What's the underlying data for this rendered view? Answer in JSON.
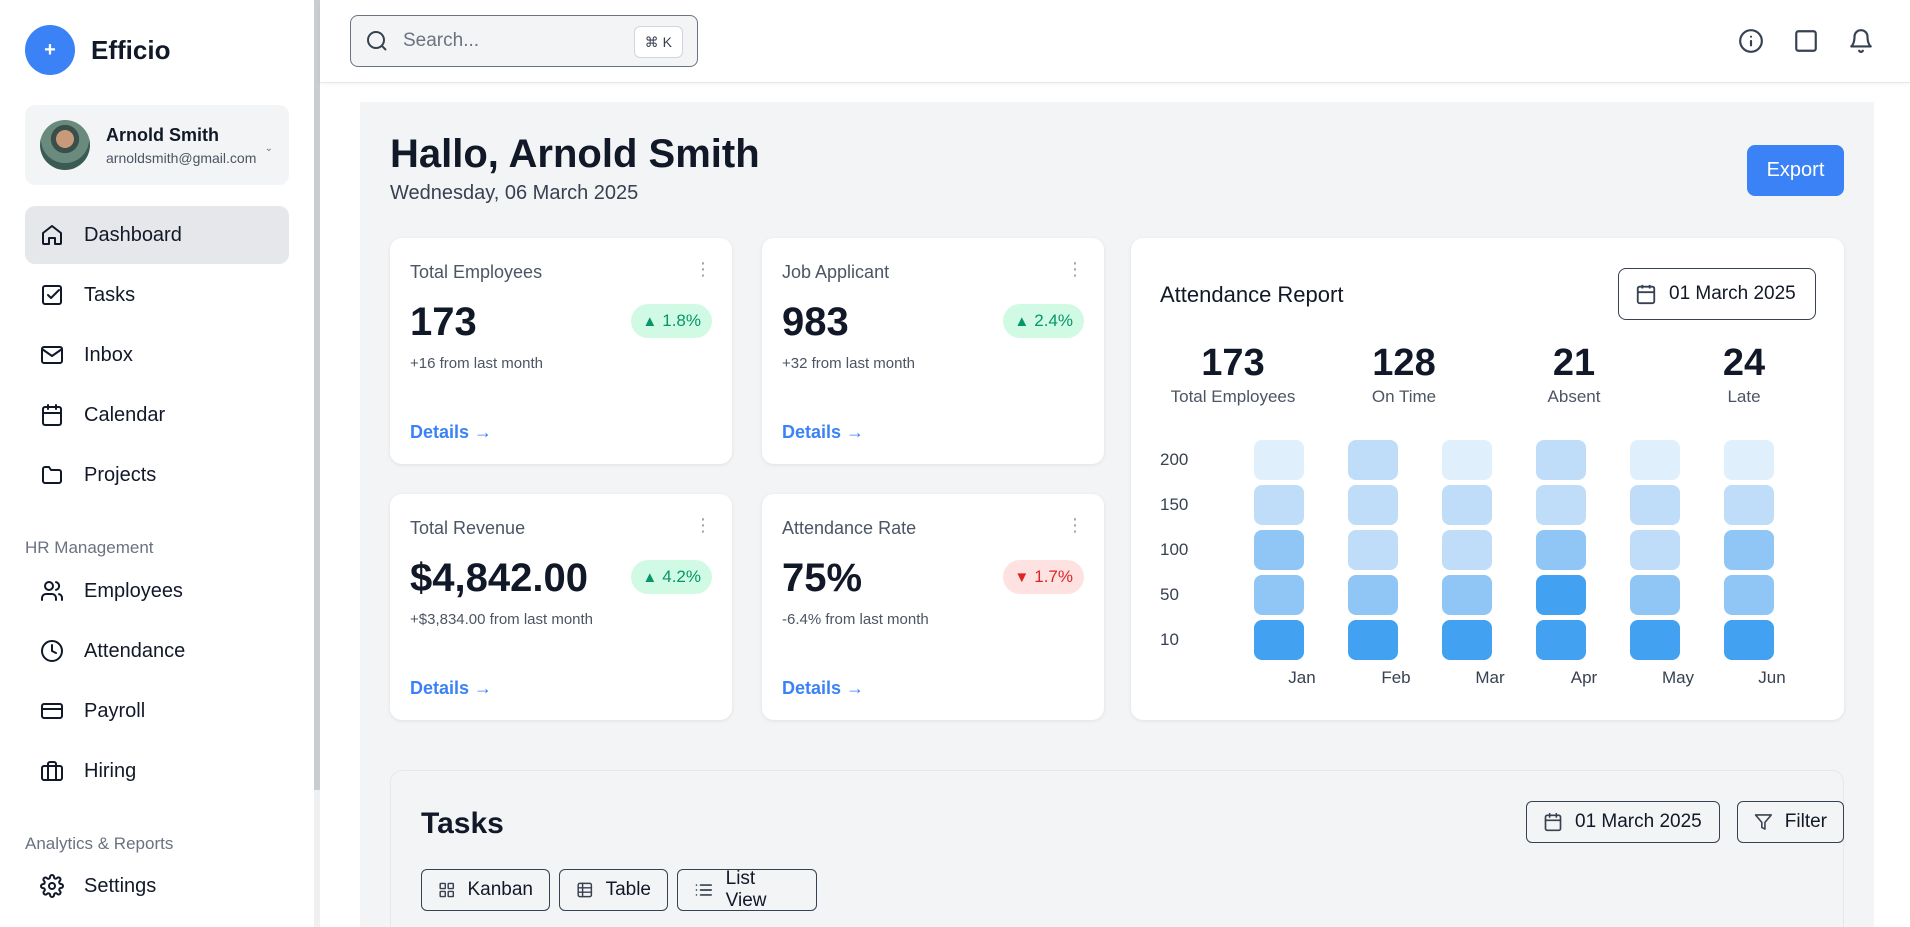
{
  "brand": {
    "logo": "+",
    "name": "Efficio"
  },
  "user": {
    "name": "Arnold Smith",
    "email": "arnoldsmith@gmail.com",
    "chevron": "⌄"
  },
  "nav": [
    {
      "label": "Dashboard",
      "icon": "home-icon",
      "active": true
    },
    {
      "label": "Tasks",
      "icon": "checkbox-icon"
    },
    {
      "label": "Inbox",
      "icon": "mail-icon"
    },
    {
      "label": "Calendar",
      "icon": "calendar-icon"
    },
    {
      "label": "Projects",
      "icon": "folder-icon"
    }
  ],
  "hr_section": {
    "label": "HR Management",
    "items": [
      {
        "label": "Employees",
        "icon": "users-icon"
      },
      {
        "label": "Attendance",
        "icon": "clock-icon"
      },
      {
        "label": "Payroll",
        "icon": "credit-card-icon"
      },
      {
        "label": "Hiring",
        "icon": "briefcase-icon"
      }
    ]
  },
  "analytics_section": {
    "label": "Analytics & Reports",
    "items": [
      {
        "label": "Settings",
        "icon": "gear-icon"
      }
    ]
  },
  "search": {
    "placeholder": "Search...",
    "shortcut": "⌘ K"
  },
  "header": {
    "greeting": "Hallo, Arnold Smith",
    "date": "Wednesday, 06 March 2025",
    "export_label": "Export"
  },
  "stats": [
    {
      "title": "Total Employees",
      "value": "173",
      "change": "1.8%",
      "direction": "up",
      "sub": "+16 from last month",
      "link": "Details →"
    },
    {
      "title": "Job Applicant",
      "value": "983",
      "change": "2.4%",
      "direction": "up",
      "sub": "+32 from last month",
      "link": "Details →"
    },
    {
      "title": "Total Revenue",
      "value": "$4,842.00",
      "change": "4.2%",
      "direction": "up",
      "sub": "+$3,834.00 from last month",
      "link": "Details →"
    },
    {
      "title": "Attendance Rate",
      "value": "75%",
      "change": "1.7%",
      "direction": "down",
      "sub": "-6.4% from last month",
      "link": "Details →"
    }
  ],
  "attendance": {
    "title": "Attendance Report",
    "date": "01 March 2025",
    "summary": [
      {
        "value": "173",
        "label": "Total Employees"
      },
      {
        "value": "128",
        "label": "On Time"
      },
      {
        "value": "21",
        "label": "Absent"
      },
      {
        "value": "24",
        "label": "Late"
      }
    ]
  },
  "chart_data": {
    "type": "heatmap",
    "title": "Attendance Report",
    "x": [
      "Jan",
      "Feb",
      "Mar",
      "Apr",
      "May",
      "Jun"
    ],
    "y": [
      "200",
      "150",
      "100",
      "50",
      "10"
    ],
    "intensity": [
      [
        1,
        2,
        1,
        2,
        1,
        1
      ],
      [
        2,
        2,
        2,
        2,
        2,
        2
      ],
      [
        3,
        2,
        2,
        3,
        2,
        3
      ],
      [
        3,
        3,
        3,
        5,
        3,
        3
      ],
      [
        5,
        5,
        5,
        5,
        5,
        5
      ]
    ],
    "colors": [
      "#ffffff",
      "#e0effc",
      "#bfdcf9",
      "#90c6f6",
      "#74b6f4",
      "#42a1f0"
    ]
  },
  "tasks": {
    "title": "Tasks",
    "date": "01 March 2025",
    "filter_label": "Filter",
    "views": [
      {
        "label": "Kanban",
        "icon": "grid-icon"
      },
      {
        "label": "Table",
        "icon": "table-icon"
      },
      {
        "label": "List View",
        "icon": "list-icon"
      }
    ]
  },
  "colors": {
    "accent": "#3b82f6",
    "up": "#059669",
    "down": "#dc2626"
  }
}
